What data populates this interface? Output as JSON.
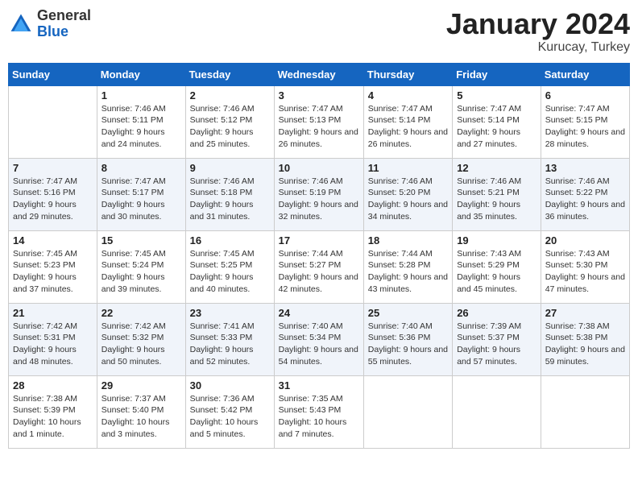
{
  "header": {
    "logo": {
      "general": "General",
      "blue": "Blue"
    },
    "title": "January 2024",
    "location": "Kurucay, Turkey"
  },
  "days_of_week": [
    "Sunday",
    "Monday",
    "Tuesday",
    "Wednesday",
    "Thursday",
    "Friday",
    "Saturday"
  ],
  "weeks": [
    [
      {
        "day": "",
        "sunrise": "",
        "sunset": "",
        "daylight": ""
      },
      {
        "day": "1",
        "sunrise": "Sunrise: 7:46 AM",
        "sunset": "Sunset: 5:11 PM",
        "daylight": "Daylight: 9 hours and 24 minutes."
      },
      {
        "day": "2",
        "sunrise": "Sunrise: 7:46 AM",
        "sunset": "Sunset: 5:12 PM",
        "daylight": "Daylight: 9 hours and 25 minutes."
      },
      {
        "day": "3",
        "sunrise": "Sunrise: 7:47 AM",
        "sunset": "Sunset: 5:13 PM",
        "daylight": "Daylight: 9 hours and 26 minutes."
      },
      {
        "day": "4",
        "sunrise": "Sunrise: 7:47 AM",
        "sunset": "Sunset: 5:14 PM",
        "daylight": "Daylight: 9 hours and 26 minutes."
      },
      {
        "day": "5",
        "sunrise": "Sunrise: 7:47 AM",
        "sunset": "Sunset: 5:14 PM",
        "daylight": "Daylight: 9 hours and 27 minutes."
      },
      {
        "day": "6",
        "sunrise": "Sunrise: 7:47 AM",
        "sunset": "Sunset: 5:15 PM",
        "daylight": "Daylight: 9 hours and 28 minutes."
      }
    ],
    [
      {
        "day": "7",
        "sunrise": "Sunrise: 7:47 AM",
        "sunset": "Sunset: 5:16 PM",
        "daylight": "Daylight: 9 hours and 29 minutes."
      },
      {
        "day": "8",
        "sunrise": "Sunrise: 7:47 AM",
        "sunset": "Sunset: 5:17 PM",
        "daylight": "Daylight: 9 hours and 30 minutes."
      },
      {
        "day": "9",
        "sunrise": "Sunrise: 7:46 AM",
        "sunset": "Sunset: 5:18 PM",
        "daylight": "Daylight: 9 hours and 31 minutes."
      },
      {
        "day": "10",
        "sunrise": "Sunrise: 7:46 AM",
        "sunset": "Sunset: 5:19 PM",
        "daylight": "Daylight: 9 hours and 32 minutes."
      },
      {
        "day": "11",
        "sunrise": "Sunrise: 7:46 AM",
        "sunset": "Sunset: 5:20 PM",
        "daylight": "Daylight: 9 hours and 34 minutes."
      },
      {
        "day": "12",
        "sunrise": "Sunrise: 7:46 AM",
        "sunset": "Sunset: 5:21 PM",
        "daylight": "Daylight: 9 hours and 35 minutes."
      },
      {
        "day": "13",
        "sunrise": "Sunrise: 7:46 AM",
        "sunset": "Sunset: 5:22 PM",
        "daylight": "Daylight: 9 hours and 36 minutes."
      }
    ],
    [
      {
        "day": "14",
        "sunrise": "Sunrise: 7:45 AM",
        "sunset": "Sunset: 5:23 PM",
        "daylight": "Daylight: 9 hours and 37 minutes."
      },
      {
        "day": "15",
        "sunrise": "Sunrise: 7:45 AM",
        "sunset": "Sunset: 5:24 PM",
        "daylight": "Daylight: 9 hours and 39 minutes."
      },
      {
        "day": "16",
        "sunrise": "Sunrise: 7:45 AM",
        "sunset": "Sunset: 5:25 PM",
        "daylight": "Daylight: 9 hours and 40 minutes."
      },
      {
        "day": "17",
        "sunrise": "Sunrise: 7:44 AM",
        "sunset": "Sunset: 5:27 PM",
        "daylight": "Daylight: 9 hours and 42 minutes."
      },
      {
        "day": "18",
        "sunrise": "Sunrise: 7:44 AM",
        "sunset": "Sunset: 5:28 PM",
        "daylight": "Daylight: 9 hours and 43 minutes."
      },
      {
        "day": "19",
        "sunrise": "Sunrise: 7:43 AM",
        "sunset": "Sunset: 5:29 PM",
        "daylight": "Daylight: 9 hours and 45 minutes."
      },
      {
        "day": "20",
        "sunrise": "Sunrise: 7:43 AM",
        "sunset": "Sunset: 5:30 PM",
        "daylight": "Daylight: 9 hours and 47 minutes."
      }
    ],
    [
      {
        "day": "21",
        "sunrise": "Sunrise: 7:42 AM",
        "sunset": "Sunset: 5:31 PM",
        "daylight": "Daylight: 9 hours and 48 minutes."
      },
      {
        "day": "22",
        "sunrise": "Sunrise: 7:42 AM",
        "sunset": "Sunset: 5:32 PM",
        "daylight": "Daylight: 9 hours and 50 minutes."
      },
      {
        "day": "23",
        "sunrise": "Sunrise: 7:41 AM",
        "sunset": "Sunset: 5:33 PM",
        "daylight": "Daylight: 9 hours and 52 minutes."
      },
      {
        "day": "24",
        "sunrise": "Sunrise: 7:40 AM",
        "sunset": "Sunset: 5:34 PM",
        "daylight": "Daylight: 9 hours and 54 minutes."
      },
      {
        "day": "25",
        "sunrise": "Sunrise: 7:40 AM",
        "sunset": "Sunset: 5:36 PM",
        "daylight": "Daylight: 9 hours and 55 minutes."
      },
      {
        "day": "26",
        "sunrise": "Sunrise: 7:39 AM",
        "sunset": "Sunset: 5:37 PM",
        "daylight": "Daylight: 9 hours and 57 minutes."
      },
      {
        "day": "27",
        "sunrise": "Sunrise: 7:38 AM",
        "sunset": "Sunset: 5:38 PM",
        "daylight": "Daylight: 9 hours and 59 minutes."
      }
    ],
    [
      {
        "day": "28",
        "sunrise": "Sunrise: 7:38 AM",
        "sunset": "Sunset: 5:39 PM",
        "daylight": "Daylight: 10 hours and 1 minute."
      },
      {
        "day": "29",
        "sunrise": "Sunrise: 7:37 AM",
        "sunset": "Sunset: 5:40 PM",
        "daylight": "Daylight: 10 hours and 3 minutes."
      },
      {
        "day": "30",
        "sunrise": "Sunrise: 7:36 AM",
        "sunset": "Sunset: 5:42 PM",
        "daylight": "Daylight: 10 hours and 5 minutes."
      },
      {
        "day": "31",
        "sunrise": "Sunrise: 7:35 AM",
        "sunset": "Sunset: 5:43 PM",
        "daylight": "Daylight: 10 hours and 7 minutes."
      },
      {
        "day": "",
        "sunrise": "",
        "sunset": "",
        "daylight": ""
      },
      {
        "day": "",
        "sunrise": "",
        "sunset": "",
        "daylight": ""
      },
      {
        "day": "",
        "sunrise": "",
        "sunset": "",
        "daylight": ""
      }
    ]
  ]
}
